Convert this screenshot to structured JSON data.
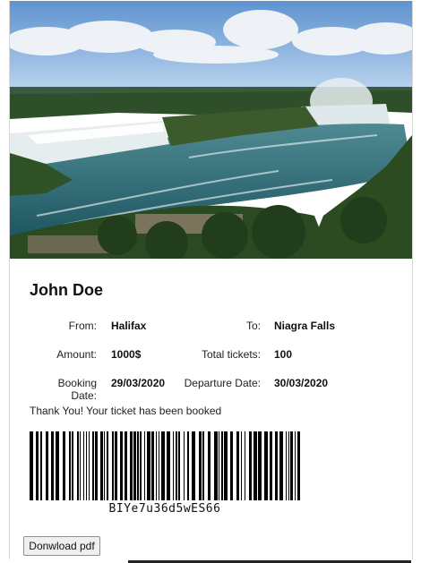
{
  "ticket": {
    "name": "John Doe",
    "from_label": "From:",
    "from_value": "Halifax",
    "to_label": "To:",
    "to_value": "Niagra Falls",
    "amount_label": "Amount:",
    "amount_value": "1000$",
    "total_label": "Total tickets:",
    "total_value": "100",
    "booking_label": "Booking Date:",
    "booking_value": "29/03/2020",
    "departure_label": "Departure Date:",
    "departure_value": "30/03/2020",
    "thanks": "Thank You! Your ticket has been booked",
    "barcode_code": "BIYe7u36d5wES66",
    "download_label": "Donwload pdf"
  },
  "colors": {
    "sky": "#8fb7e3",
    "water": "#2f6e7a",
    "foliage": "#2a4a22",
    "button_bg": "#efefef"
  }
}
